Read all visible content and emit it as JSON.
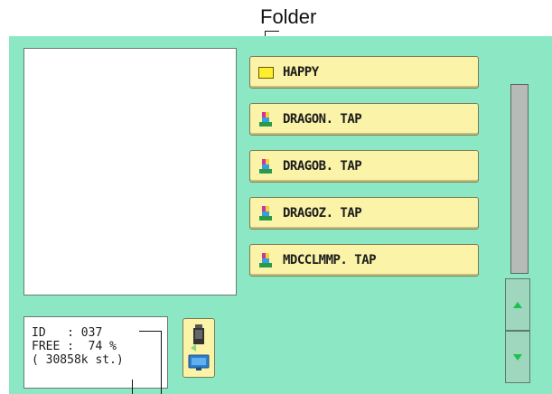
{
  "annotation": {
    "label": "Folder"
  },
  "files": [
    {
      "name": "HAPPY",
      "icon": "folder-icon"
    },
    {
      "name": "DRAGON. TAP",
      "icon": "tap-file-icon"
    },
    {
      "name": "DRAGOB. TAP",
      "icon": "tap-file-icon"
    },
    {
      "name": "DRAGOZ. TAP",
      "icon": "tap-file-icon"
    },
    {
      "name": "MDCCLMMP. TAP",
      "icon": "tap-file-icon"
    }
  ],
  "info": {
    "id_line": "ID   : 037",
    "free_line": "FREE :  74 %",
    "stitches_line": "( 30858k st.)"
  },
  "colors": {
    "panel": "#8ce8c4",
    "button": "#faf3a8",
    "scroll_arrow": "#1ec04e"
  }
}
